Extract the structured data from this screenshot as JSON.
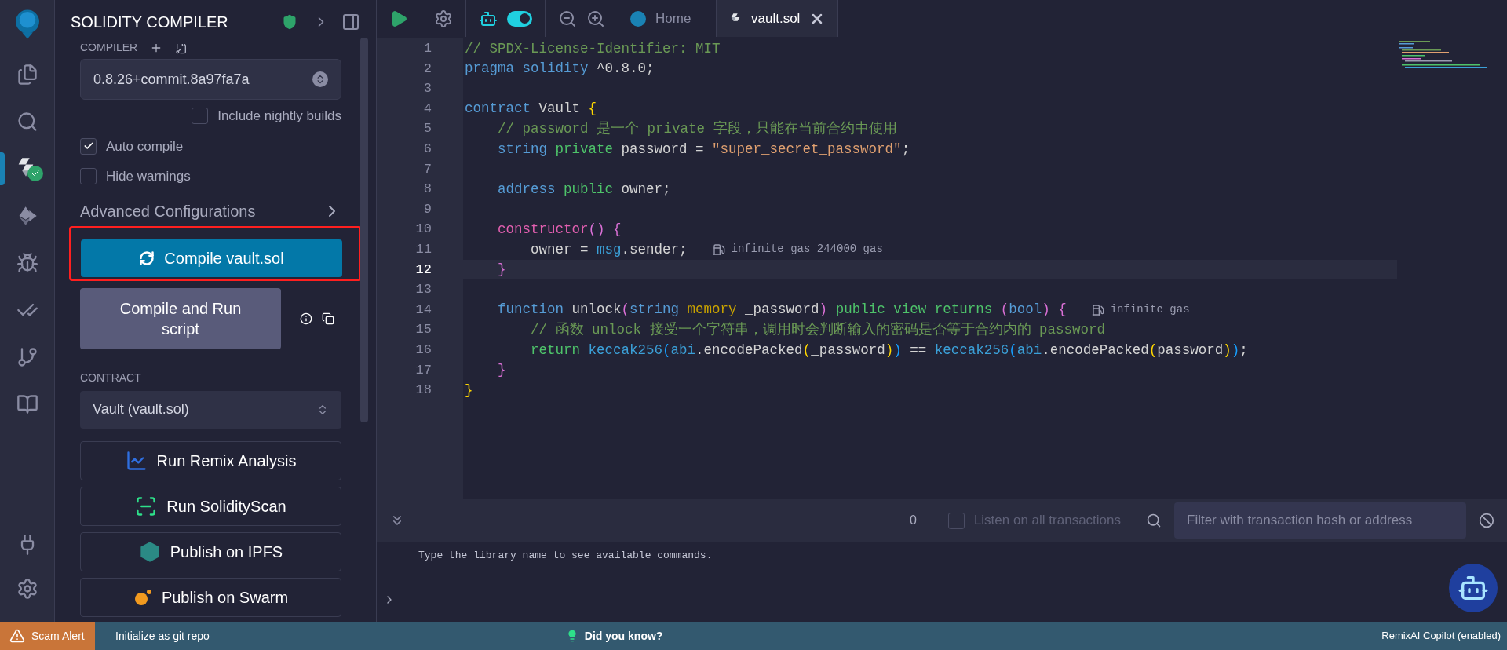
{
  "icon_bar": {
    "items": [
      {
        "kind": "files",
        "selected": false
      },
      {
        "kind": "search",
        "selected": false
      },
      {
        "kind": "compiler",
        "selected": true
      },
      {
        "kind": "deploy",
        "selected": false
      },
      {
        "kind": "debug",
        "selected": false
      },
      {
        "kind": "tests",
        "selected": false
      },
      {
        "kind": "git",
        "selected": false
      },
      {
        "kind": "learn",
        "selected": false
      }
    ],
    "bottom_items": [
      {
        "kind": "plugins",
        "selected": false
      },
      {
        "kind": "settings",
        "selected": false
      }
    ]
  },
  "panel": {
    "title": "SOLIDITY COMPILER",
    "compiler_label": "COMPILER",
    "compiler_version": "0.8.26+commit.8a97fa7a",
    "options": [
      {
        "label": "Include nightly builds",
        "checked": false,
        "kind": "right"
      },
      {
        "label": "Auto compile",
        "checked": true,
        "kind": "left"
      },
      {
        "label": "Hide warnings",
        "checked": false,
        "kind": "left"
      }
    ],
    "advanced": "Advanced Configurations",
    "compile_button": {
      "label": "Compile vault.sol",
      "highlighted": true
    },
    "run_script_button": "Compile and Run script",
    "contract_label": "CONTRACT",
    "contract": "Vault (vault.sol)",
    "actions": [
      {
        "kind": "analysis",
        "label": "Run Remix Analysis"
      },
      {
        "kind": "scan",
        "label": "Run SolidityScan"
      },
      {
        "kind": "ipfs",
        "label": "Publish on IPFS"
      },
      {
        "kind": "swarm",
        "label": "Publish on Swarm"
      }
    ]
  },
  "toolbar": {
    "copilot_toggle": {
      "on": true
    },
    "tabs": [
      {
        "kind": "home",
        "label": "Home",
        "selected": false
      },
      {
        "kind": "file",
        "label": "vault.sol",
        "selected": true
      }
    ]
  },
  "editor": {
    "lines": [
      {
        "number": "1",
        "active": false,
        "tokens": [
          {
            "kind": "comment",
            "text": "// SPDX-License-Identifier: MIT"
          }
        ]
      },
      {
        "number": "2",
        "active": false,
        "tokens": [
          {
            "kind": "kw",
            "text": "pragma "
          },
          {
            "kind": "kw",
            "text": "solidity "
          },
          {
            "kind": "plain",
            "text": "^0.8.0;"
          }
        ]
      },
      {
        "number": "3",
        "active": false
      },
      {
        "number": "4",
        "active": false,
        "tokens": [
          {
            "kind": "kw",
            "text": "contract "
          },
          {
            "kind": "plain",
            "text": "Vault "
          },
          {
            "kind": "b1",
            "text": "{"
          }
        ]
      },
      {
        "number": "5",
        "active": false,
        "tokens": [
          {
            "kind": "comment",
            "text": "    // password 是一个 private 字段，只能在当前合约中使用"
          }
        ]
      },
      {
        "number": "6",
        "active": false,
        "tokens": [
          {
            "kind": "kw",
            "text": "    string "
          },
          {
            "kind": "mod",
            "text": "private "
          },
          {
            "kind": "plain",
            "text": "password = "
          },
          {
            "kind": "str",
            "text": "\"super_secret_password\""
          },
          {
            "kind": "plain",
            "text": ";"
          }
        ]
      },
      {
        "number": "7",
        "active": false
      },
      {
        "number": "8",
        "active": false,
        "tokens": [
          {
            "kind": "kw",
            "text": "    address "
          },
          {
            "kind": "mod",
            "text": "public "
          },
          {
            "kind": "plain",
            "text": "owner;"
          }
        ]
      },
      {
        "number": "9",
        "active": false
      },
      {
        "number": "10",
        "active": false,
        "tokens": [
          {
            "kind": "fn",
            "text": "    constructor"
          },
          {
            "kind": "b2",
            "text": "() {"
          }
        ]
      },
      {
        "number": "11",
        "active": false,
        "tokens": [
          {
            "kind": "plain",
            "text": "        owner = "
          },
          {
            "kind": "builtin",
            "text": "msg"
          },
          {
            "kind": "plain",
            "text": ".sender;"
          }
        ],
        "hint": "infinite gas 244000 gas"
      },
      {
        "number": "12",
        "active": true,
        "tokens": [
          {
            "kind": "b2",
            "text": "    }"
          }
        ]
      },
      {
        "number": "13",
        "active": false
      },
      {
        "number": "14",
        "active": false,
        "tokens": [
          {
            "kind": "kw",
            "text": "    function "
          },
          {
            "kind": "plain",
            "text": "unlock"
          },
          {
            "kind": "b2",
            "text": "("
          },
          {
            "kind": "kw",
            "text": "string "
          },
          {
            "kind": "mem",
            "text": "memory "
          },
          {
            "kind": "plain",
            "text": "_password"
          },
          {
            "kind": "b2",
            "text": ") "
          },
          {
            "kind": "mod",
            "text": "public view returns "
          },
          {
            "kind": "b2",
            "text": "("
          },
          {
            "kind": "kw",
            "text": "bool"
          },
          {
            "kind": "b2",
            "text": ") {"
          }
        ],
        "hint": "infinite gas"
      },
      {
        "number": "15",
        "active": false,
        "tokens": [
          {
            "kind": "comment",
            "text": "        // 函数 unlock 接受一个字符串，调用时会判断输入的密码是否等于合约内的 password"
          }
        ]
      },
      {
        "number": "16",
        "active": false,
        "tokens": [
          {
            "kind": "mod",
            "text": "        return "
          },
          {
            "kind": "builtin",
            "text": "keccak256"
          },
          {
            "kind": "b3",
            "text": "("
          },
          {
            "kind": "builtin",
            "text": "abi"
          },
          {
            "kind": "plain",
            "text": ".encodePacked"
          },
          {
            "kind": "b1",
            "text": "("
          },
          {
            "kind": "plain",
            "text": "_password"
          },
          {
            "kind": "b1",
            "text": ")"
          },
          {
            "kind": "b3",
            "text": ")"
          },
          {
            "kind": "plain",
            "text": " == "
          },
          {
            "kind": "builtin",
            "text": "keccak256"
          },
          {
            "kind": "b3",
            "text": "("
          },
          {
            "kind": "builtin",
            "text": "abi"
          },
          {
            "kind": "plain",
            "text": ".encodePacked"
          },
          {
            "kind": "b1",
            "text": "("
          },
          {
            "kind": "plain",
            "text": "password"
          },
          {
            "kind": "b1",
            "text": ")"
          },
          {
            "kind": "b3",
            "text": ")"
          },
          {
            "kind": "plain",
            "text": ";"
          }
        ]
      },
      {
        "number": "17",
        "active": false,
        "tokens": [
          {
            "kind": "b2",
            "text": "    }"
          }
        ]
      },
      {
        "number": "18",
        "active": false,
        "tokens": [
          {
            "kind": "b1",
            "text": "}"
          }
        ]
      }
    ]
  },
  "terminal": {
    "count": "0",
    "listen": {
      "label": "Listen on all transactions",
      "checked": false
    },
    "filter": {
      "placeholder": "Filter with transaction hash or address"
    },
    "output": "Type the library name to see available commands."
  },
  "status_bar": {
    "alert": "Scam Alert",
    "git": "Initialize as git repo",
    "tip": "Did you know?",
    "copilot": "RemixAI Copilot (enabled)"
  }
}
